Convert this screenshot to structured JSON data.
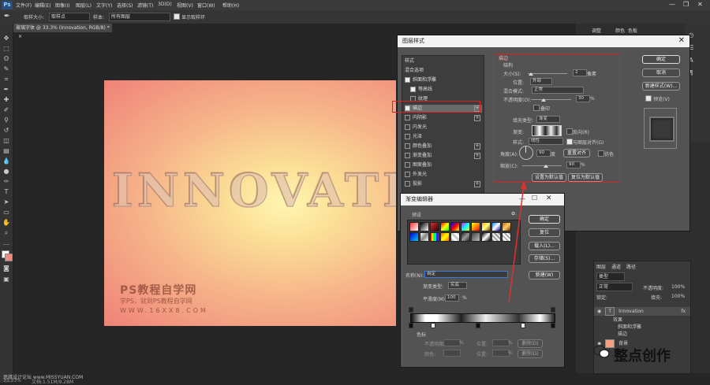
{
  "app": {
    "logo": "Ps"
  },
  "menubar": {
    "items": [
      "文件(F)",
      "编辑(E)",
      "图像(I)",
      "图层(L)",
      "文字(Y)",
      "选择(S)",
      "滤镜(T)",
      "3D(D)",
      "视图(V)",
      "窗口(W)",
      "帮助(H)"
    ]
  },
  "window_controls": {
    "minimize": "—",
    "maximize": "❐",
    "close": "✕"
  },
  "options_bar": {
    "sample_size_label": "取样大小:",
    "sample_size_value": "取样点",
    "sample_label": "样本:",
    "sample_value": "所有图层",
    "show_ring_label": "显示取样环"
  },
  "document": {
    "tab_title": "玻璃字体 @ 33.3% (Innovation, RGB/8) *",
    "tab_close": "×",
    "emboss_text": "INNOVATIO",
    "watermark_title": "PS教程自学网",
    "watermark_sub": "学PS，就到PS教程自学网",
    "watermark_url": "WWW.16XX8.COM"
  },
  "status": {
    "zoom": "33.33%",
    "doc": "文档:1.51M/9.28M",
    "credit": "思缘设计论坛 www.MISSYUAN.COM"
  },
  "layer_style": {
    "title": "图层样式",
    "close": "✕",
    "styles_header": "样式",
    "blend_options": "混合选项",
    "items": [
      {
        "label": "斜面和浮雕",
        "checked": true,
        "plus": false
      },
      {
        "label": "等高线",
        "checked": true,
        "plus": false
      },
      {
        "label": "纹理",
        "checked": false,
        "plus": false
      },
      {
        "label": "描边",
        "checked": true,
        "plus": true
      },
      {
        "label": "内阴影",
        "checked": false,
        "plus": true
      },
      {
        "label": "内发光",
        "checked": false,
        "plus": false
      },
      {
        "label": "光泽",
        "checked": false,
        "plus": false
      },
      {
        "label": "颜色叠加",
        "checked": false,
        "plus": true
      },
      {
        "label": "渐变叠加",
        "checked": false,
        "plus": true
      },
      {
        "label": "图案叠加",
        "checked": false,
        "plus": false
      },
      {
        "label": "外发光",
        "checked": false,
        "plus": false
      },
      {
        "label": "投影",
        "checked": false,
        "plus": true
      }
    ],
    "stroke": {
      "section": "描边",
      "structure": "结构",
      "size_label": "大小(S):",
      "size_value": "2",
      "size_unit": "像素",
      "position_label": "位置:",
      "position_value": "外部",
      "blend_label": "混合模式:",
      "blend_value": "正常",
      "opacity_label": "不透明度(O):",
      "opacity_value": "30",
      "opacity_unit": "%",
      "opacity_level": 0.3,
      "overprint_label": "叠印",
      "fill_type_label": "填充类型:",
      "fill_type_value": "渐变",
      "gradient_label": "渐变:",
      "reverse_label": "反向(R)",
      "style_label": "样式:",
      "style_value": "线性",
      "align_label": "与图层对齐(G)",
      "angle_label": "角度(A):",
      "angle_value": "90",
      "angle_unit": "度",
      "reset_align": "重置对齐",
      "dither_label": "仿色",
      "scale_label": "缩放(C):",
      "scale_value": "90",
      "scale_unit": "%",
      "scale_level": 0.6,
      "set_default": "设置为默认值",
      "reset_default": "复位为默认值"
    },
    "buttons": {
      "ok": "确定",
      "cancel": "取消",
      "new_style": "新建样式(W)...",
      "preview": "预览(V)"
    }
  },
  "gradient_editor": {
    "title": "渐变编辑器",
    "presets_label": "预设",
    "gear": "✿.",
    "ok": "确定",
    "reset": "复位",
    "load": "载入(L)...",
    "save": "存储(S)...",
    "name_label": "名称(N):",
    "name_value": "自定",
    "new": "新建(W)",
    "type_label": "渐变类型:",
    "type_value": "实底",
    "smooth_label": "平滑度(M):",
    "smooth_value": "100",
    "smooth_unit": "%",
    "color_stops": "色标",
    "opacity_label": "不透明度:",
    "location_label": "位置:",
    "delete_label": "删除(D)",
    "color_label": "颜色:",
    "pct": "%"
  },
  "layers_panel": {
    "tabs": [
      "图层",
      "通道",
      "路径"
    ],
    "kind": "类型",
    "mode": "正常",
    "opacity_label": "不透明度:",
    "opacity_value": "100%",
    "lock_label": "锁定:",
    "fill_label": "填充:",
    "fill_value": "100%",
    "layers": [
      {
        "name": "Innovation",
        "fx": "fx"
      },
      {
        "name": "效果"
      },
      {
        "name": "斜面和浮雕"
      },
      {
        "name": "描边"
      },
      {
        "name": "背景"
      }
    ]
  },
  "right_panel": {
    "tabs": [
      "颜色",
      "色板"
    ],
    "tab3": "调整"
  },
  "wechat": {
    "text": "整点创作"
  }
}
